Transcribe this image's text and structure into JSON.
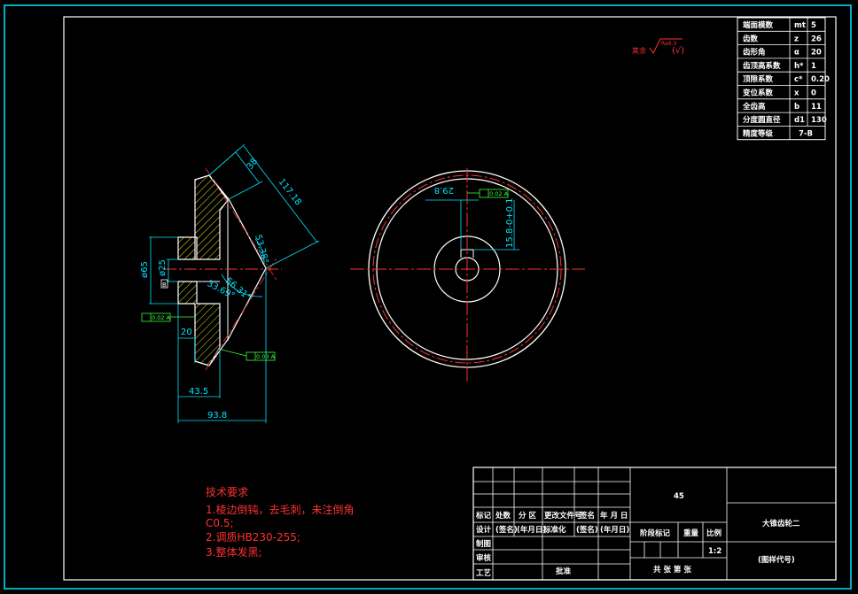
{
  "colors": {
    "background": "#000000",
    "frame": "#ffffff",
    "dimension": "#00e5ff",
    "centerline": "#ff3030",
    "tolerance": "#3cff3c",
    "hatch": "#e0e020",
    "part": "#ffffff"
  },
  "params_table": [
    {
      "name": "端面模数",
      "sym": "mt",
      "val": "5"
    },
    {
      "name": "齿数",
      "sym": "z",
      "val": "26"
    },
    {
      "name": "齿形角",
      "sym": "α",
      "val": "20"
    },
    {
      "name": "齿顶高系数",
      "sym": "h*",
      "val": "1"
    },
    {
      "name": "顶隙系数",
      "sym": "c*",
      "val": "0.20"
    },
    {
      "name": "变位系数",
      "sym": "x",
      "val": "0"
    },
    {
      "name": "全齿高",
      "sym": "b",
      "val": "11"
    },
    {
      "name": "分度圆直径",
      "sym": "d1",
      "val": "130"
    },
    {
      "name": "精度等级",
      "sym": "",
      "val": "7-B"
    }
  ],
  "roughness": {
    "prefix": "其余",
    "value": "Ra6.3",
    "suffix": "(√)"
  },
  "side_view": {
    "dims": {
      "top_width": "38",
      "cone_length": "117.18",
      "angle_1": "53.38°",
      "angle_2": "56.31°",
      "angle_3": "33.69°",
      "dia_hub": "ø65",
      "dia_bore": "ø25",
      "hub_len": "20",
      "width_1": "43.5",
      "width_total": "93.8",
      "datum": "B"
    },
    "tol_1": "0.02 A",
    "tol_2": "0.03 A"
  },
  "front_view": {
    "key_dim": "29.8",
    "keyway": "15.8-0+0.1",
    "tol": "0.02 A"
  },
  "tech_notes": {
    "title": "技术要求",
    "lines": [
      "1.棱边倒钝，去毛刺，未注倒角",
      "C0.5;",
      "2.调质HB230-255;",
      "3.整体发黑;"
    ]
  },
  "title_block": {
    "material": "45",
    "part_name": "大锥齿轮二",
    "drawing_no": "(图样代号)",
    "scale": "1:2",
    "row_labels": [
      "标记",
      "处数",
      "分 区",
      "更改文件号",
      "签名",
      "年 月 日"
    ],
    "design_row": [
      "设计",
      "(签名)",
      "(年月日)",
      "标准化",
      "(签名)",
      "(年月日)"
    ],
    "stage_labels": [
      "阶段标记",
      "重量",
      "比例"
    ],
    "left_labels": [
      "制图",
      "审核",
      "工艺"
    ],
    "approve": "批准",
    "sheets": "共 张 第 张"
  }
}
